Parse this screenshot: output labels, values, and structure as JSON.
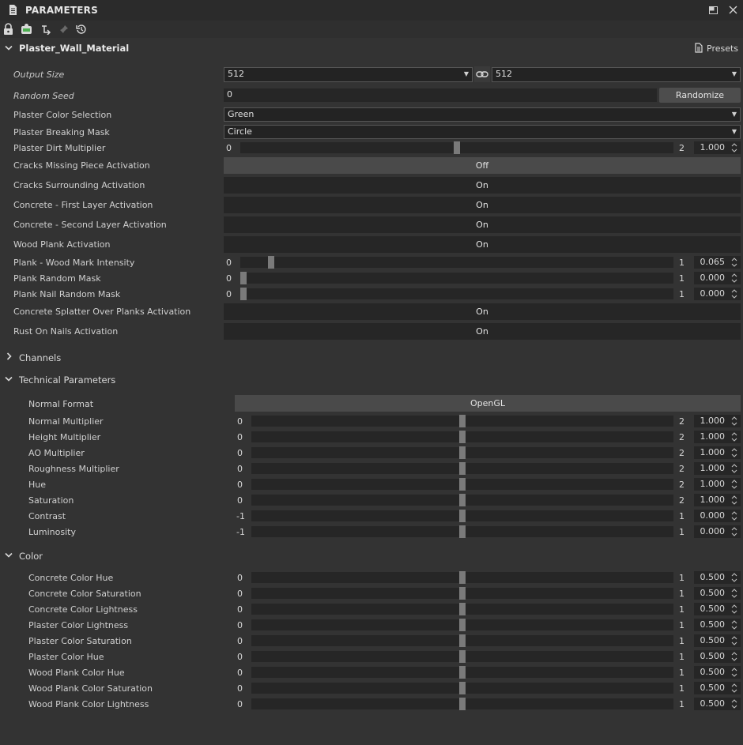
{
  "panel": {
    "title": "PARAMETERS"
  },
  "graph": {
    "name": "Plaster_Wall_Material",
    "presets_label": "Presets"
  },
  "output_size": {
    "label": "Output Size",
    "left": "512",
    "right": "512"
  },
  "random_seed": {
    "label": "Random Seed",
    "value": "0",
    "button": "Randomize"
  },
  "combos": [
    {
      "label": "Plaster Color Selection",
      "value": "Green"
    },
    {
      "label": "Plaster Breaking Mask",
      "value": "Circle"
    }
  ],
  "main_params": [
    {
      "type": "slider",
      "label": "Plaster Dirt Multiplier",
      "min": "0",
      "max": "2",
      "value": "1.000",
      "frac": 0.5
    },
    {
      "type": "toggle",
      "label": "Cracks Missing Piece Activation",
      "value": "Off"
    },
    {
      "type": "toggle",
      "label": "Cracks Surrounding Activation",
      "value": "On"
    },
    {
      "type": "toggle",
      "label": "Concrete - First Layer Activation",
      "value": "On"
    },
    {
      "type": "toggle",
      "label": "Concrete - Second Layer Activation",
      "value": "On"
    },
    {
      "type": "toggle",
      "label": "Wood Plank Activation",
      "value": "On"
    },
    {
      "type": "slider",
      "label": "Plank - Wood Mark Intensity",
      "min": "0",
      "max": "1",
      "value": "0.065",
      "frac": 0.065
    },
    {
      "type": "slider",
      "label": "Plank Random Mask",
      "min": "0",
      "max": "1",
      "value": "0.000",
      "frac": 0.0
    },
    {
      "type": "slider",
      "label": "Plank Nail Random Mask",
      "min": "0",
      "max": "1",
      "value": "0.000",
      "frac": 0.0
    },
    {
      "type": "toggle",
      "label": "Concrete Splatter Over Planks Activation",
      "value": "On"
    },
    {
      "type": "toggle",
      "label": "Rust On Nails Activation",
      "value": "On"
    }
  ],
  "sections": {
    "channels": "Channels",
    "technical": "Technical Parameters",
    "color": "Color"
  },
  "normal_format": {
    "label": "Normal Format",
    "value": "OpenGL"
  },
  "technical_params": [
    {
      "label": "Normal Multiplier",
      "min": "0",
      "max": "2",
      "value": "1.000",
      "frac": 0.5
    },
    {
      "label": "Height Multiplier",
      "min": "0",
      "max": "2",
      "value": "1.000",
      "frac": 0.5
    },
    {
      "label": "AO Multiplier",
      "min": "0",
      "max": "2",
      "value": "1.000",
      "frac": 0.5
    },
    {
      "label": "Roughness Multiplier",
      "min": "0",
      "max": "2",
      "value": "1.000",
      "frac": 0.5
    },
    {
      "label": "Hue",
      "min": "0",
      "max": "2",
      "value": "1.000",
      "frac": 0.5
    },
    {
      "label": "Saturation",
      "min": "0",
      "max": "2",
      "value": "1.000",
      "frac": 0.5
    },
    {
      "label": "Contrast",
      "min": "-1",
      "max": "1",
      "value": "0.000",
      "frac": 0.5
    },
    {
      "label": "Luminosity",
      "min": "-1",
      "max": "1",
      "value": "0.000",
      "frac": 0.5
    }
  ],
  "color_params": [
    {
      "label": "Concrete Color Hue",
      "min": "0",
      "max": "1",
      "value": "0.500",
      "frac": 0.5
    },
    {
      "label": "Concrete Color Saturation",
      "min": "0",
      "max": "1",
      "value": "0.500",
      "frac": 0.5
    },
    {
      "label": "Concrete Color Lightness",
      "min": "0",
      "max": "1",
      "value": "0.500",
      "frac": 0.5
    },
    {
      "label": "Plaster Color Lightness",
      "min": "0",
      "max": "1",
      "value": "0.500",
      "frac": 0.5
    },
    {
      "label": "Plaster Color Saturation",
      "min": "0",
      "max": "1",
      "value": "0.500",
      "frac": 0.5
    },
    {
      "label": "Plaster Color Hue",
      "min": "0",
      "max": "1",
      "value": "0.500",
      "frac": 0.5
    },
    {
      "label": "Wood Plank Color Hue",
      "min": "0",
      "max": "1",
      "value": "0.500",
      "frac": 0.5
    },
    {
      "label": "Wood Plank Color Saturation",
      "min": "0",
      "max": "1",
      "value": "0.500",
      "frac": 0.5
    },
    {
      "label": "Wood Plank Color Lightness",
      "min": "0",
      "max": "1",
      "value": "0.500",
      "frac": 0.5
    }
  ],
  "toolbar_icons": [
    "lock-icon",
    "instance-icon",
    "link-node-icon",
    "pin-icon",
    "reset-icon"
  ],
  "colors": {
    "background": "#333333",
    "titlebar": "#2b2b2b",
    "field": "#262626",
    "toggle_off": "#4a4a4a",
    "thumb": "#7a7a7a"
  }
}
